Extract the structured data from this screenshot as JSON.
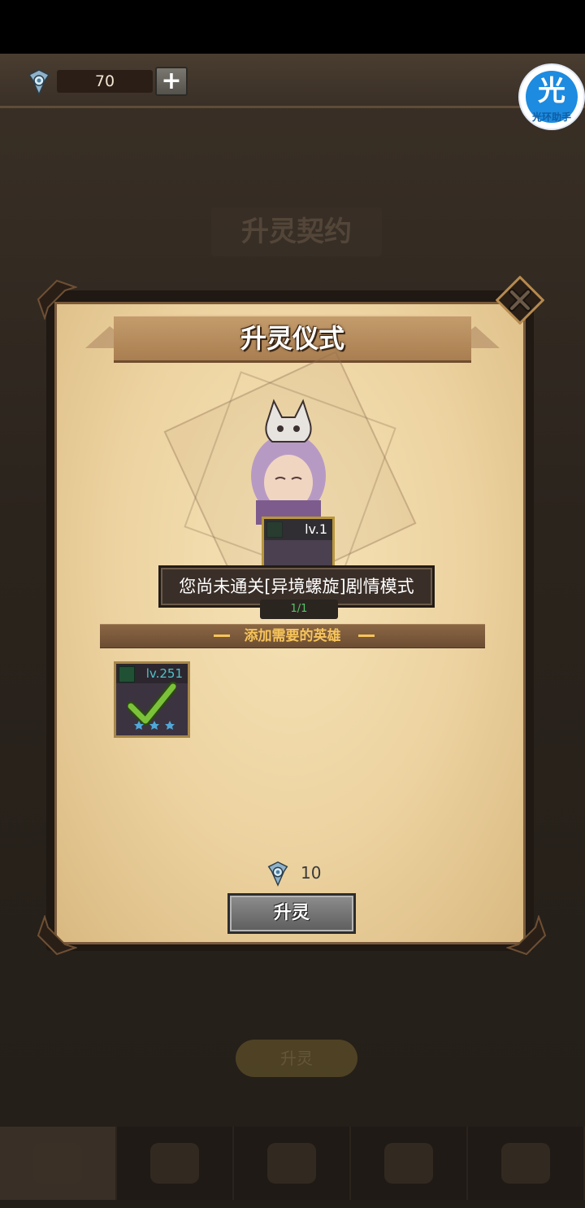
{
  "currency": {
    "icon": "spirit-gem-icon",
    "amount": "70",
    "add_label": "+"
  },
  "assistant": {
    "glyph": "光",
    "caption": "光环助手"
  },
  "background": {
    "blurred_title": "升灵契约",
    "blurred_button": "升灵"
  },
  "dialog": {
    "title": "升灵仪式",
    "close_icon": "close-x-icon",
    "hero_card": {
      "level": "lv.1",
      "element_icon": "leaf-element-icon"
    },
    "tooltip": "您尚未通关[异境螺旋]剧情模式",
    "count": "1/1",
    "section_label": "添加需要的英雄",
    "slots": [
      {
        "level": "lv.251",
        "selected": true,
        "element_icon": "leaf-element-icon"
      }
    ],
    "cost": {
      "icon": "spirit-gem-icon",
      "amount": "10"
    },
    "ascend_button": "升灵"
  },
  "colors": {
    "parchment": "#ecd29f",
    "frame": "#1f1813",
    "accent_gold": "#f6c45a",
    "check_green": "#7bc23a",
    "assistant_blue": "#1d8be0"
  }
}
